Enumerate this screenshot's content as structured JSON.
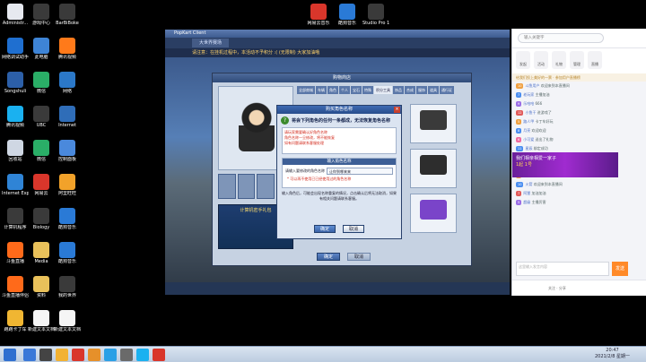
{
  "desktop_icons": [
    {
      "label": "Administr...",
      "color": "#e6e9f0"
    },
    {
      "label": "游戏中心",
      "color": "#3a3a3a"
    },
    {
      "label": "BarBiBoke",
      "color": "#3a3a3a"
    },
    {
      "label": "网络调试助手",
      "color": "#1f6fd0"
    },
    {
      "label": "此电脑",
      "color": "#3e84d6"
    },
    {
      "label": "腾讯视频",
      "color": "#ff7a1a"
    },
    {
      "label": "Songshuli",
      "color": "#2c5fa8"
    },
    {
      "label": "微信",
      "color": "#2aae67"
    },
    {
      "label": "网络",
      "color": "#2b78c8"
    },
    {
      "label": "腾讯视频",
      "color": "#1ab1f0"
    },
    {
      "label": "UBC",
      "color": "#3a3a3a"
    },
    {
      "label": "Internet",
      "color": "#2f6db8"
    },
    {
      "label": "回收站",
      "color": "#cfd7e3"
    },
    {
      "label": "微信",
      "color": "#2aae67"
    },
    {
      "label": "控制面板",
      "color": "#4a89dc"
    },
    {
      "label": "Internet Explorer",
      "color": "#2f84d6"
    },
    {
      "label": "网易云",
      "color": "#d9362b"
    },
    {
      "label": "阿里旺旺",
      "color": "#f2a22a"
    },
    {
      "label": "计算机程序",
      "color": "#3a3a3a"
    },
    {
      "label": "Biology",
      "color": "#3a3a3a"
    },
    {
      "label": "酷狗音乐",
      "color": "#2a7ad6"
    },
    {
      "label": "斗鱼直播",
      "color": "#ff6a1a"
    },
    {
      "label": "Media",
      "color": "#e9c15a"
    },
    {
      "label": "酷狗音乐",
      "color": "#2a7ad6"
    },
    {
      "label": "斗鱼直播伴侣",
      "color": "#ff6a1a"
    },
    {
      "label": "资料",
      "color": "#e9c15a"
    },
    {
      "label": "我的世界",
      "color": "#3a3a3a"
    },
    {
      "label": "跑跑卡丁车",
      "color": "#f0b632"
    },
    {
      "label": "新建文本文档.txt",
      "color": "#f5f5f5"
    },
    {
      "label": "新建文本文档",
      "color": "#f5f5f5"
    }
  ],
  "top_icons": [
    {
      "label": "网易云音乐",
      "color": "#d9362b"
    },
    {
      "label": "酷狗音乐",
      "color": "#2a7ad6"
    },
    {
      "label": "Studio Pro 1",
      "color": "#3a3a3a"
    }
  ],
  "game": {
    "title": "PopKart Client",
    "top_tab": "大世界赛场",
    "notice": "请注意：在挂机过程中，本活动不予积分 :( (无限制) 大家加油哦",
    "panel_title": "购物商店",
    "shop_tabs": [
      "全部商城",
      "车辆",
      "角色",
      "个人",
      "宝石",
      "特殊",
      "积分工具",
      "饰品",
      "合成",
      "服饰",
      "道具",
      "通行证"
    ],
    "card_title": "计算机密手礼包",
    "panel_ok": "确定",
    "panel_cancel": "取消"
  },
  "dialog": {
    "title": "购买角色名称",
    "close": "×",
    "question": "将会下列角色的任何一条都成，无法恢复角色名称",
    "warnings": [
      "请玩家需要确认好角色名称",
      "角色名称一旦修改，将不能恢复",
      "如有问题请联系客服处理"
    ],
    "sub_title": "输入角色名称",
    "sub_label": "请输入要修改的角色名称",
    "sub_value": "让你到哪来来",
    "sub_warning": "* 可以再不使用已已经使用过的角色名称",
    "tip": "输入角色后，可能会出现名称重复的情况，点击确认后将无法取消，如果有相关问题请联系客服。",
    "ok": "确定",
    "cancel": "取消"
  },
  "live": {
    "search_placeholder": "输入关键字",
    "toolbar": [
      "发起",
      "活动",
      "礼物",
      "管理",
      "直播"
    ],
    "ticker": "给我们投上美好的一票 · 参加用户直播榜",
    "banner_title": "我们相亲相爱一家子",
    "banner_sub": "1起 1号",
    "chat": [
      {
        "badge": "10",
        "badge_color": "#f0a040",
        "user": "斗鱼用户",
        "text": "欢迎来到本直播间"
      },
      {
        "badge": "7",
        "badge_color": "#4b8ef0",
        "user": "老玩家",
        "text": "主播加油"
      },
      {
        "badge": "9",
        "badge_color": "#9c6ee6",
        "user": "乐哈哈",
        "text": "666"
      },
      {
        "badge": "12",
        "badge_color": "#e15a5a",
        "user": "小鱼干",
        "text": "进游戏了"
      },
      {
        "badge": "5",
        "badge_color": "#f0a040",
        "user": "路人甲",
        "text": "卡丁车好玩"
      },
      {
        "badge": "8",
        "badge_color": "#4b8ef0",
        "user": "月亮",
        "text": "欢迎欢迎"
      },
      {
        "badge": "6",
        "badge_color": "#f06aa0",
        "user": "小可爱",
        "text": "送出了礼物"
      },
      {
        "badge": "11",
        "badge_color": "#4b8ef0",
        "user": "星辰",
        "text": "绑定成功"
      },
      {
        "badge": "4",
        "badge_color": "#e15a5a",
        "user": "阿杰",
        "text": "欢迎来到本直播间"
      },
      {
        "badge": "9",
        "badge_color": "#9c6ee6",
        "user": "柚子",
        "text": "送出了礼物"
      },
      {
        "badge": "3",
        "badge_color": "#f0a040",
        "user": "小白",
        "text": "打卡"
      },
      {
        "badge": "10",
        "badge_color": "#4b8ef0",
        "user": "火箭",
        "text": "欢迎来到本直播间"
      },
      {
        "badge": "7",
        "badge_color": "#e15a5a",
        "user": "阿狸",
        "text": "加油加油"
      },
      {
        "badge": "5",
        "badge_color": "#9c6ee6",
        "user": "超级",
        "text": "主播厉害"
      }
    ],
    "input_placeholder": "这里输入发言内容",
    "send": "发送",
    "bottom": "关注 · 分享"
  },
  "taskbar": {
    "items": [
      "#3a78d8",
      "#444",
      "#f2b233",
      "#d9362b",
      "#e6902a",
      "#2aa0e6",
      "#6a6a6a",
      "#1ab1f0",
      "#d9362b"
    ],
    "time": "20:47",
    "date": "2021/2/8 星期一"
  }
}
